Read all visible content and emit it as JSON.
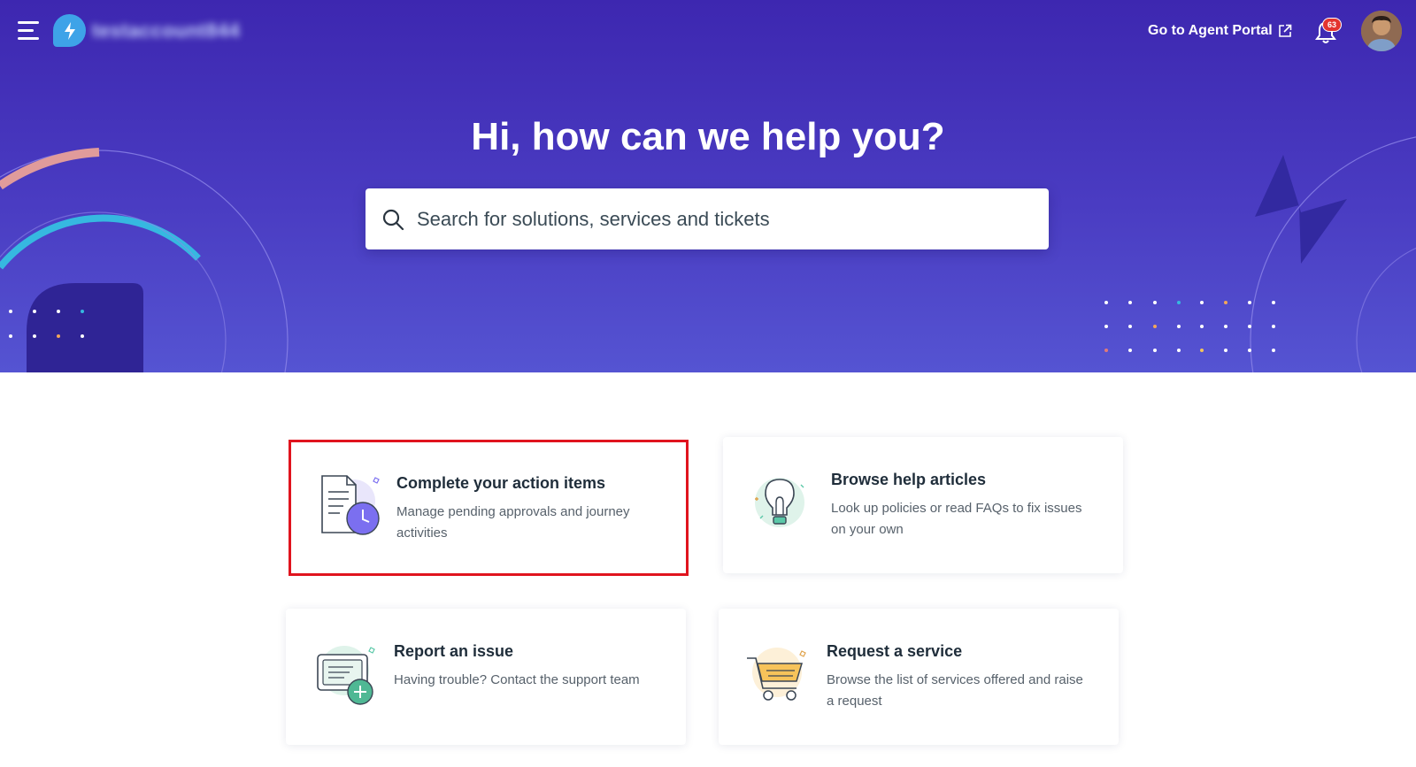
{
  "header": {
    "account_name": "testaccount844",
    "agent_portal_label": "Go to Agent Portal",
    "notification_count": "63"
  },
  "hero": {
    "title": "Hi, how can we help you?",
    "search_placeholder": "Search for solutions, services and tickets"
  },
  "cards": [
    {
      "title": "Complete your action items",
      "description": "Manage pending approvals and journey activities",
      "icon": "document-clock-icon"
    },
    {
      "title": "Browse help articles",
      "description": "Look up policies or read FAQs to fix issues on your own",
      "icon": "lightbulb-icon"
    },
    {
      "title": "Report an issue",
      "description": "Having trouble? Contact the support team",
      "icon": "ticket-add-icon"
    },
    {
      "title": "Request a service",
      "description": "Browse the list of services offered and raise a request",
      "icon": "shopping-cart-icon"
    }
  ],
  "colors": {
    "hero_top": "#3d27b0",
    "hero_bottom": "#5554d2",
    "highlight_border": "#e0141e",
    "badge": "#e3342f"
  }
}
